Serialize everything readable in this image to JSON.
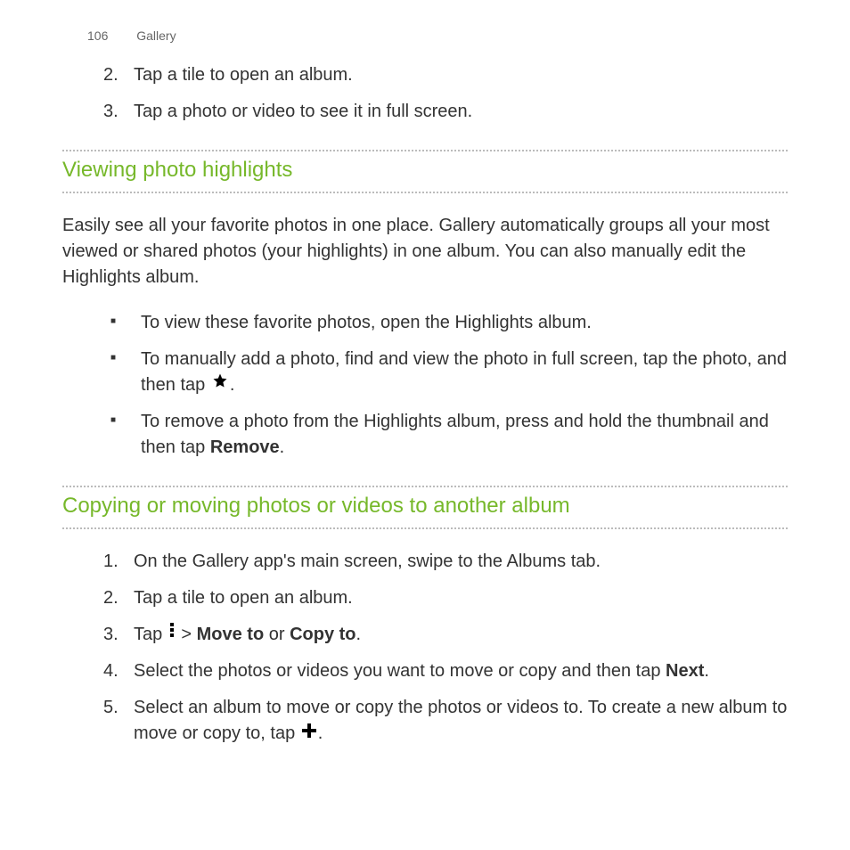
{
  "header": {
    "page_number": "106",
    "section": "Gallery"
  },
  "top_steps": [
    {
      "n": "2.",
      "text": "Tap a tile to open an album."
    },
    {
      "n": "3.",
      "text": "Tap a photo or video to see it in full screen."
    }
  ],
  "section1": {
    "title": "Viewing photo highlights",
    "intro": "Easily see all your favorite photos in one place. Gallery automatically groups all your most viewed or shared photos (your highlights) in one album. You can also manually edit the Highlights album.",
    "bullets": {
      "b0": "To view these favorite photos, open the Highlights album.",
      "b1_pre": "To manually add a photo, find and view the photo in full screen, tap the photo, and then tap ",
      "b1_post": ".",
      "b2_pre": "To remove a photo from the Highlights album, press and hold the thumbnail and then tap ",
      "b2_bold": "Remove",
      "b2_post": "."
    }
  },
  "section2": {
    "title": "Copying or moving photos or videos to another album",
    "steps": {
      "s1": {
        "n": "1.",
        "text": "On the Gallery app's main screen, swipe to the Albums tab."
      },
      "s2": {
        "n": "2.",
        "text": "Tap a tile to open an album."
      },
      "s3": {
        "n": "3.",
        "pre": "Tap ",
        "mid": " > ",
        "bold1": "Move to",
        "or": " or ",
        "bold2": "Copy to",
        "post": "."
      },
      "s4": {
        "n": "4.",
        "pre": "Select the photos or videos you want to move or copy and then tap ",
        "bold": "Next",
        "post": "."
      },
      "s5": {
        "n": "5.",
        "pre": "Select an album to move or copy the photos or videos to. To create a new album to move or copy to, tap ",
        "post": "."
      }
    }
  },
  "icons": {
    "star": "star-icon",
    "more": "more-icon",
    "plus": "plus-icon"
  }
}
